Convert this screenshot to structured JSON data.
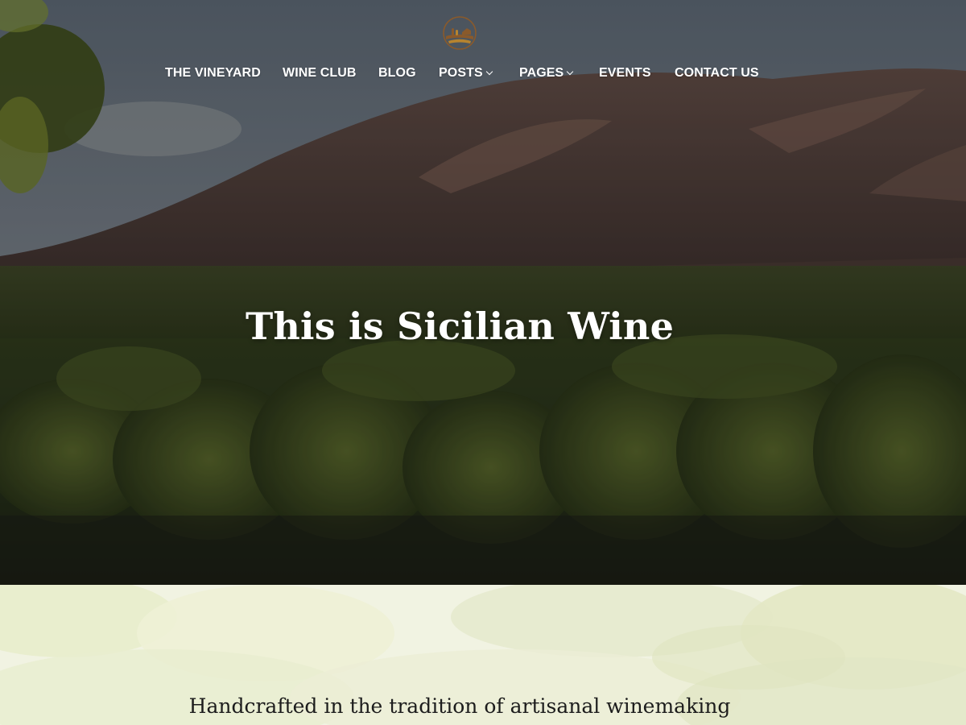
{
  "header": {
    "logo_icon": "vineyard-logo-icon",
    "nav": [
      {
        "label": "THE VINEYARD",
        "has_dropdown": false
      },
      {
        "label": "WINE CLUB",
        "has_dropdown": false
      },
      {
        "label": "BLOG",
        "has_dropdown": false
      },
      {
        "label": "POSTS",
        "has_dropdown": true
      },
      {
        "label": "PAGES",
        "has_dropdown": true
      },
      {
        "label": "EVENTS",
        "has_dropdown": false
      },
      {
        "label": "CONTACT US",
        "has_dropdown": false
      }
    ]
  },
  "hero": {
    "title": "This is Sicilian Wine"
  },
  "intro": {
    "tagline": "Handcrafted in the tradition of artisanal winemaking"
  },
  "colors": {
    "logo_brown": "#8a5a2b",
    "logo_gold": "#b7842f",
    "nav_text": "#ffffff",
    "tagline_text": "#1c1c1c"
  }
}
